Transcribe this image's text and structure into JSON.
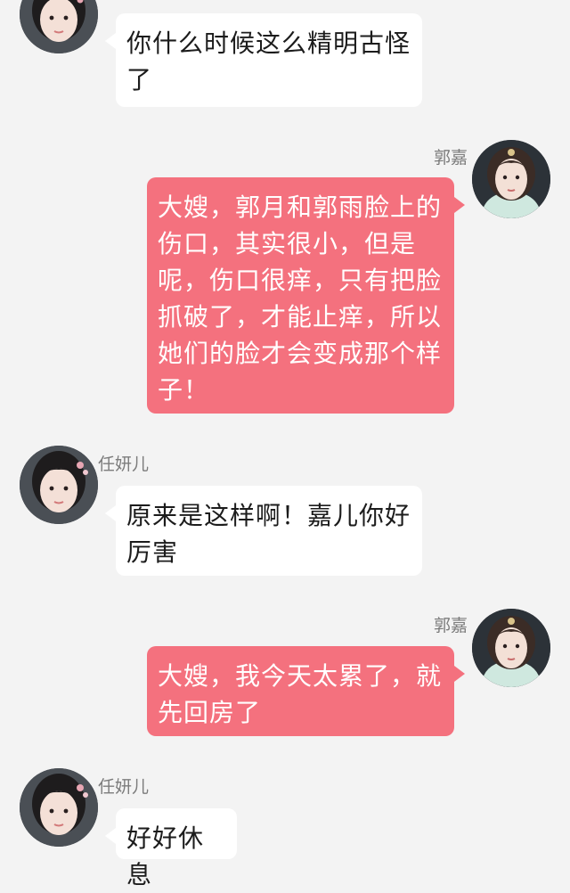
{
  "chat": {
    "messages": [
      {
        "sender": "",
        "text": "你什么时候这么精明古怪了"
      },
      {
        "sender": "郭嘉",
        "text": "大嫂，郭月和郭雨脸上的伤口，其实很小，但是呢，伤口很痒，只有把脸抓破了，才能止痒，所以她们的脸才会变成那个样子！"
      },
      {
        "sender": "任妍儿",
        "text": "原来是这样啊！嘉儿你好厉害"
      },
      {
        "sender": "郭嘉",
        "text": "大嫂，我今天太累了，就先回房了"
      },
      {
        "sender": "任妍儿",
        "text": "好好休息"
      }
    ]
  },
  "colors": {
    "background": "#f3f3f3",
    "incoming_bubble": "#ffffff",
    "outgoing_bubble": "#f4717e",
    "sender_name": "#7c7c7c"
  },
  "icons": {
    "incoming_avatar": "woman-portrait-icon",
    "outgoing_avatar": "woman-portrait-icon"
  }
}
